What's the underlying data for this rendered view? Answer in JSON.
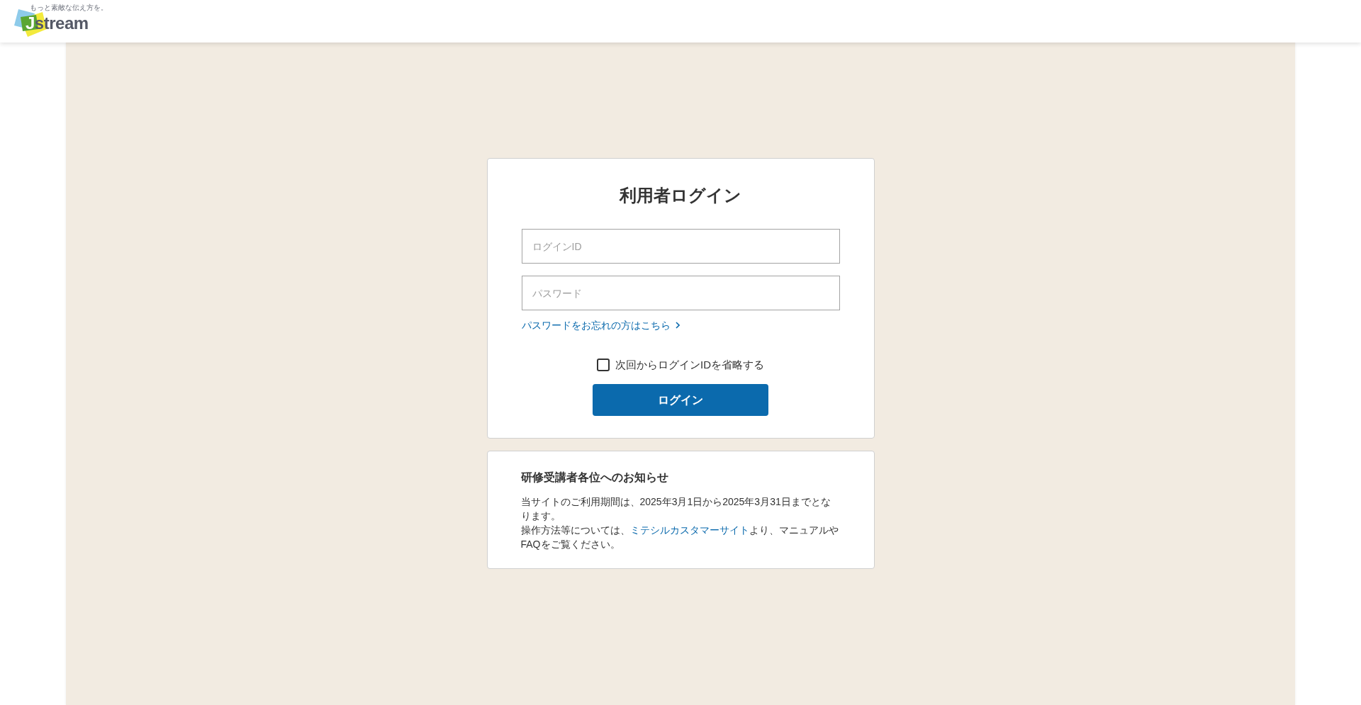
{
  "header": {
    "logo": {
      "tagline": "もっと素敵な伝え方を。",
      "initial": "J",
      "rest": "stream"
    }
  },
  "login": {
    "title": "利用者ログイン",
    "fields": [
      {
        "placeholder": "ログインID"
      },
      {
        "placeholder": "パスワード"
      }
    ],
    "forgot_link": "パスワードをお忘れの方はこちら",
    "remember": {
      "label": "次回からログインIDを省略する",
      "checked": false
    },
    "submit": "ログイン"
  },
  "notice": {
    "title": "研修受講者各位へのお知らせ",
    "paragraphs": [
      {
        "segments": [
          {
            "kind": "text",
            "text": "当サイトのご利用期間は、2025年3月1日から2025年3月31日までとなります。"
          }
        ]
      },
      {
        "segments": [
          {
            "kind": "text",
            "text": "操作方法等については、"
          },
          {
            "kind": "link",
            "text": "ミテシルカスタマーサイト"
          },
          {
            "kind": "text",
            "text": "より、マニュアルやFAQをご覧ください。"
          }
        ]
      }
    ]
  }
}
